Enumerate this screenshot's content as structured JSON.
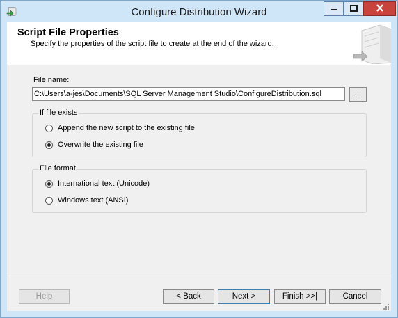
{
  "window": {
    "title": "Configure Distribution Wizard",
    "accent": "#cfe5f8",
    "close_color": "#c8433b",
    "icons": {
      "app": "wizard-app-icon",
      "minimize": "minimize-icon",
      "maximize": "maximize-icon",
      "close": "close-icon"
    }
  },
  "header": {
    "title": "Script File Properties",
    "subtitle": "Specify the properties of the script file to create at the end of the wizard."
  },
  "file": {
    "label": "File name:",
    "value": "C:\\Users\\a-jes\\Documents\\SQL Server Management Studio\\ConfigureDistribution.sql",
    "browse_label": "..."
  },
  "if_exists": {
    "title": "If file exists",
    "options": [
      {
        "label": "Append the new script to the existing file",
        "selected": false
      },
      {
        "label": "Overwrite the existing file",
        "selected": true
      }
    ]
  },
  "file_format": {
    "title": "File format",
    "options": [
      {
        "label": "International text (Unicode)",
        "selected": true
      },
      {
        "label": "Windows text (ANSI)",
        "selected": false
      }
    ]
  },
  "buttons": {
    "help": "Help",
    "back": "< Back",
    "next": "Next >",
    "finish": "Finish >>|",
    "cancel": "Cancel"
  }
}
